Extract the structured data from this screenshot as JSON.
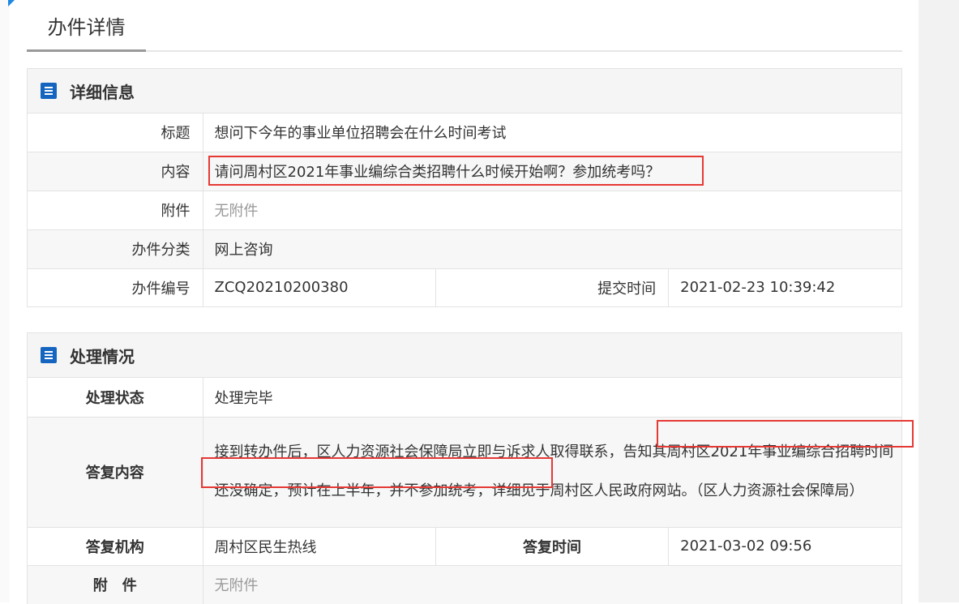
{
  "page": {
    "title": "办件详情"
  },
  "details": {
    "title": "详细信息",
    "rows": {
      "subject": {
        "label": "标题",
        "value": "想问下今年的事业单位招聘会在什么时间考试"
      },
      "content": {
        "label": "内容",
        "value": "请问周村区2021年事业编综合类招聘什么时候开始啊？参加统考吗？"
      },
      "attachment": {
        "label": "附件",
        "value": "无附件"
      },
      "category": {
        "label": "办件分类",
        "value": "网上咨询"
      },
      "number": {
        "label": "办件编号",
        "value": "ZCQ20210200380"
      },
      "submit_time": {
        "label": "提交时间",
        "value": "2021-02-23 10:39:42"
      }
    }
  },
  "processing": {
    "title": "处理情况",
    "rows": {
      "status": {
        "label": "处理状态",
        "value": "处理完毕"
      },
      "reply": {
        "label": "答复内容",
        "value": "接到转办件后，区人力资源社会保障局立即与诉求人取得联系，告知其周村区2021年事业编综合招聘时间还没确定，预计在上半年，并不参加统考，详细见于周村区人民政府网站。（区人力资源社会保障局）"
      },
      "agency": {
        "label": "答复机构",
        "value": "周村区民生热线"
      },
      "reply_time": {
        "label": "答复时间",
        "value": "2021-03-02 09:56"
      },
      "attachment": {
        "label": "附　件",
        "value": "无附件"
      }
    }
  },
  "colors": {
    "accent": "#1565c0",
    "highlight": "#e53935"
  }
}
